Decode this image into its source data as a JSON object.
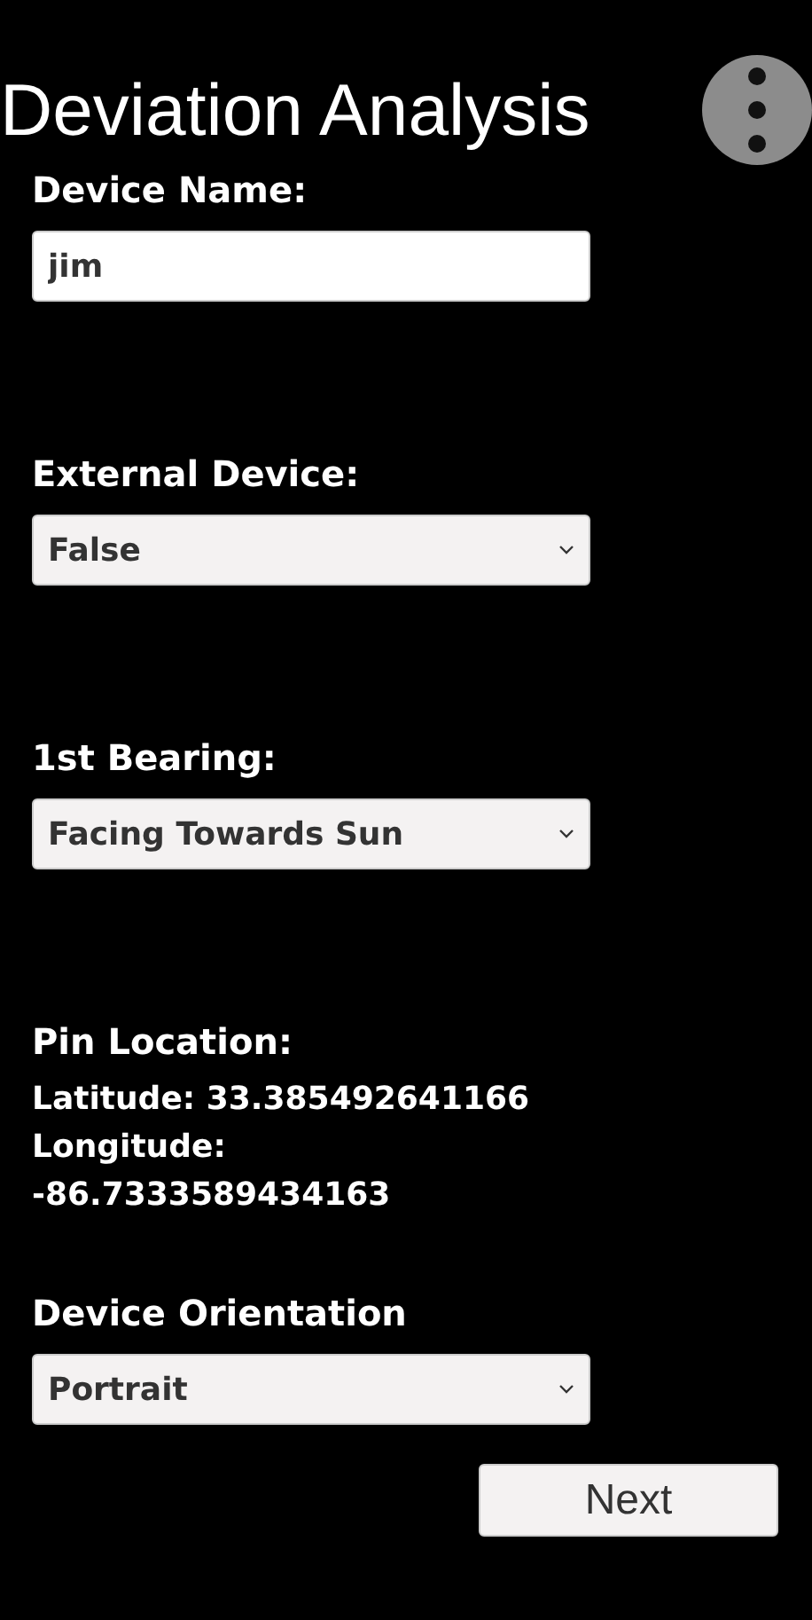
{
  "title": "Deviation Analysis",
  "fields": [
    {
      "kind": "text",
      "label": "Device Name:",
      "value": "jim"
    },
    {
      "kind": "select",
      "label": "External Device:",
      "value": "False"
    },
    {
      "kind": "select",
      "label": "1st Bearing:",
      "value": "Facing Towards Sun"
    }
  ],
  "pin_location": {
    "label": "Pin Location:",
    "latitude": "Latitude: 33.385492641166",
    "longitude_label": "Longitude:",
    "longitude": "-86.7333589434163"
  },
  "orientation": {
    "kind": "select",
    "label": "Device Orientation",
    "value": "Portrait"
  },
  "next_button": "Next"
}
